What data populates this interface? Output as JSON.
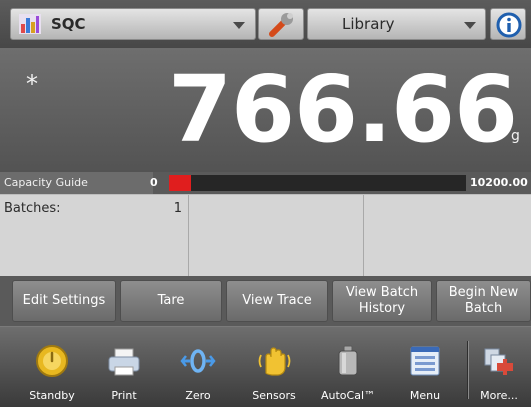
{
  "topbar": {
    "application": "SQC",
    "library": "Library"
  },
  "display": {
    "stability_indicator": "*",
    "weight": "766.66",
    "unit": "g"
  },
  "capacity_guide": {
    "label": "Capacity Guide",
    "min": "0",
    "max": "10200.00",
    "fill_fraction": 0.075,
    "fill_color": "#e01e1e"
  },
  "grid": {
    "batches_label": "Batches:",
    "batches_value": "1"
  },
  "actions": [
    {
      "label": "Edit Settings"
    },
    {
      "label": "Tare"
    },
    {
      "label": "View Trace"
    },
    {
      "label": "View Batch History"
    },
    {
      "label": "Begin New Batch"
    }
  ],
  "iconbar": [
    {
      "label": "Standby",
      "icon": "standby-icon"
    },
    {
      "label": "Print",
      "icon": "printer-icon"
    },
    {
      "label": "Zero",
      "icon": "zero-icon"
    },
    {
      "label": "Sensors",
      "icon": "hand-sensor-icon"
    },
    {
      "label": "AutoCal™",
      "icon": "calibration-weight-icon"
    },
    {
      "label": "Menu",
      "icon": "menu-icon"
    },
    {
      "label": "More...",
      "icon": "more-icon"
    }
  ],
  "colors": {
    "accent_red": "#e01e1e",
    "button_gray": "#7c7c7c",
    "display_bg": "#606060"
  }
}
